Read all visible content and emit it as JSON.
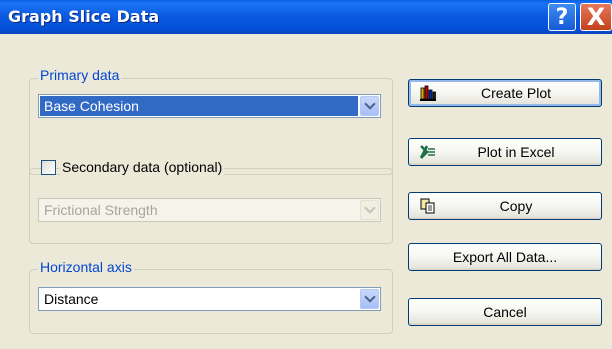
{
  "window": {
    "title": "Graph Slice Data",
    "help_glyph": "?",
    "close_glyph": "X"
  },
  "primary": {
    "legend": "Primary data",
    "selected": "Base Cohesion"
  },
  "secondary": {
    "checkbox_label": "Secondary data (optional)",
    "checked": false,
    "selected": "Frictional Strength",
    "enabled": false
  },
  "horizontal": {
    "legend": "Horizontal axis",
    "selected": "Distance"
  },
  "buttons": {
    "create_plot": "Create Plot",
    "plot_excel": "Plot in Excel",
    "copy": "Copy",
    "export_all": "Export All Data...",
    "cancel": "Cancel"
  },
  "icons": {
    "create_plot": "bar-chart-icon",
    "plot_excel": "excel-icon",
    "copy": "copy-icon"
  },
  "colors": {
    "title_bar": "#0a58e0",
    "legend_text": "#0046d5",
    "selection": "#316ac5"
  }
}
